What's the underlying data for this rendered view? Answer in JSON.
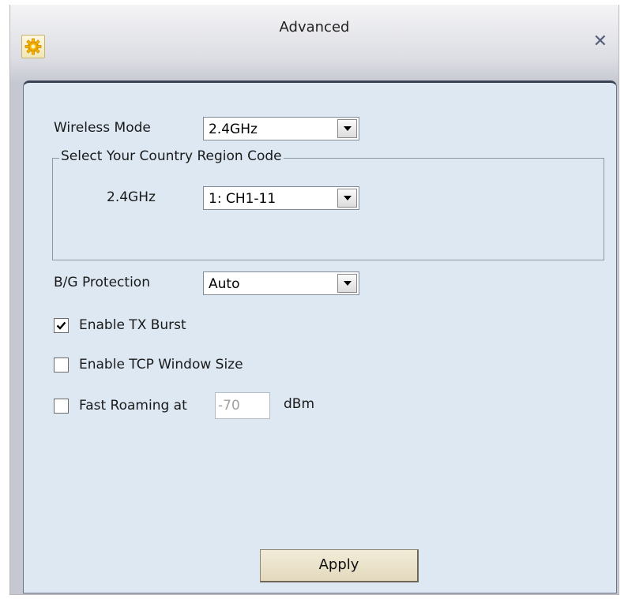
{
  "window": {
    "title": "Advanced"
  },
  "wireless_mode": {
    "label": "Wireless Mode",
    "value": "2.4GHz"
  },
  "country_region": {
    "group_label": "Select Your Country Region Code",
    "band_label": "2.4GHz",
    "value": "1: CH1-11"
  },
  "bg_protection": {
    "label": "B/G Protection",
    "value": "Auto"
  },
  "tx_burst": {
    "label": "Enable TX Burst",
    "checked": true
  },
  "tcp_window": {
    "label": "Enable TCP Window Size",
    "checked": false
  },
  "fast_roaming": {
    "label": "Fast Roaming at",
    "value": "-70",
    "unit": "dBm",
    "checked": false
  },
  "apply_label": "Apply",
  "icons": {
    "settings": "gear-icon",
    "close": "close-icon",
    "dropdown": "chevron-down-icon",
    "check": "check-icon"
  },
  "colors": {
    "panel_bg": "#dde8f2",
    "button_bg": "#ece4ca",
    "gear_color": "#f5b700"
  }
}
